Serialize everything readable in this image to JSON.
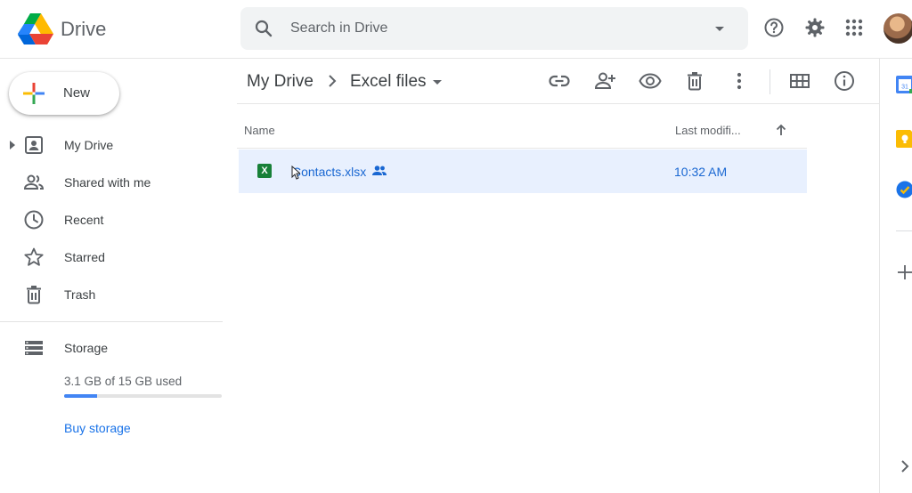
{
  "app": {
    "title": "Drive"
  },
  "search": {
    "placeholder": "Search in Drive"
  },
  "new_button": {
    "label": "New"
  },
  "sidebar": {
    "items": [
      {
        "label": "My Drive",
        "icon": "my-drive-icon"
      },
      {
        "label": "Shared with me",
        "icon": "shared-with-me-icon"
      },
      {
        "label": "Recent",
        "icon": "clock-icon"
      },
      {
        "label": "Starred",
        "icon": "star-icon"
      },
      {
        "label": "Trash",
        "icon": "trash-icon"
      }
    ],
    "storage": {
      "label": "Storage",
      "used_text": "3.1 GB of 15 GB used",
      "used_fraction": 0.207,
      "buy_label": "Buy storage"
    }
  },
  "breadcrumb": {
    "root": "My Drive",
    "current": "Excel files"
  },
  "file_list": {
    "columns": {
      "name": "Name",
      "last_modified": "Last modifi..."
    },
    "files": [
      {
        "icon_letter": "X",
        "name": "Contacts.xlsx",
        "modified": "10:32 AM",
        "shared": true
      }
    ]
  },
  "side_panel": {
    "calendar_day": "31"
  },
  "colors": {
    "accent": "#1a73e8",
    "selected_row": "#e8f0fe",
    "excel_green": "#188038",
    "storage_fill": "#4285f4"
  }
}
